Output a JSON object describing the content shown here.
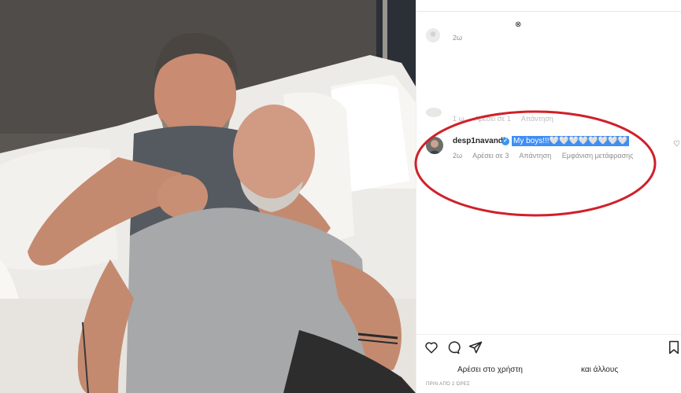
{
  "post": {
    "top_comment": {
      "time": "2ω"
    },
    "comment_prev": {
      "time": "1 ω",
      "likes": "Αρέσει σε 1",
      "reply": "Απάντηση"
    },
    "highlighted_comment": {
      "username": "desp1navandi",
      "verified": "✓",
      "text": "My boys!!!🤍🤍🤍🤍🤍🤍🤍🤍",
      "time": "2ω",
      "likes": "Αρέσει σε 3",
      "reply": "Απάντηση",
      "translate": "Εμφάνιση μετάφρασης"
    },
    "likes_line": {
      "left": "Αρέσει στο χρήστη",
      "right": "και άλλους"
    },
    "timestamp": "ΠΡΙΝ ΑΠΌ 2 ΏΡΕΣ"
  },
  "icons": {
    "like": "heart-icon",
    "comment": "comment-icon",
    "share": "share-icon",
    "save": "bookmark-icon",
    "comment_like": "heart-small-icon"
  },
  "colors": {
    "highlight": "#3e8ef7",
    "verified": "#3897f0",
    "annotation": "#d0202a",
    "muted_text": "#8e8e8e"
  }
}
